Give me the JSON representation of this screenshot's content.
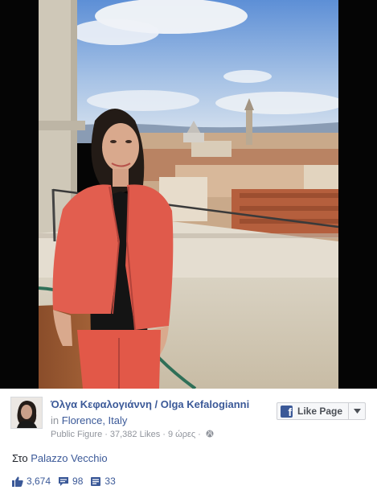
{
  "post": {
    "page_name": "Όλγα Κεφαλογιάννη / Olga Kefalogianni",
    "location_prefix": "in",
    "location": "Florence, Italy",
    "category": "Public Figure",
    "likes_count": "37,382 Likes",
    "time_ago": "9 ώρες",
    "caption_prefix": "Στο",
    "caption_place": "Palazzo Vecchio"
  },
  "actions": {
    "like_page_label": "Like Page"
  },
  "stats": {
    "likes": "3,674",
    "comments": "98",
    "shares": "33"
  },
  "icons": {
    "like_page": "facebook-logo-icon",
    "dropdown": "chevron-down-icon",
    "privacy": "globe-icon",
    "likes": "thumbs-up-icon",
    "comments": "comment-icon",
    "shares": "share-icon"
  },
  "colors": {
    "link": "#3b5998",
    "meta": "#90949c",
    "photo_border": "#050505"
  }
}
